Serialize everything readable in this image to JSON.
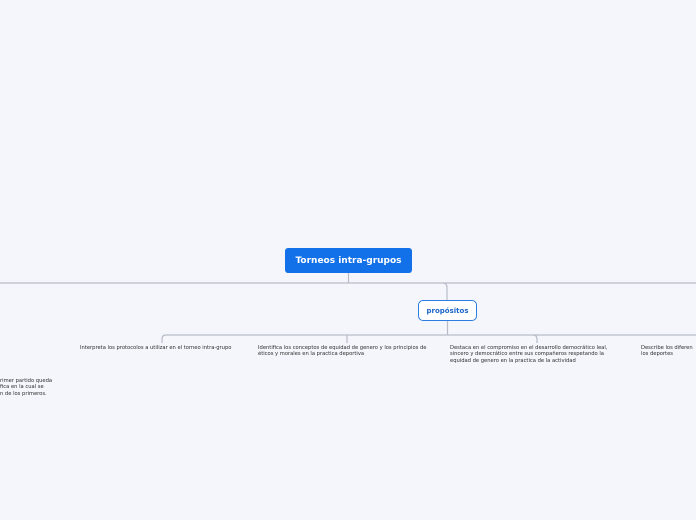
{
  "root": {
    "label": "Torneos intra-grupos"
  },
  "sub": {
    "label": "propósitos"
  },
  "leaves": {
    "item1": "Interpreta los protocolos a utilizar en el torneo intra-grupo",
    "item2": "Identifica los conceptos de equidad de genero y los principios de éticos y morales en la practica deportiva",
    "item3": "Destaca en el compromiso en el desarrollo democrático leal, sincero y democrático entre sus compañeros respetando la equidad de genero en la practica de la actividad",
    "item4_line1": "Describe los diferen",
    "item4_line2": "los deportes",
    "left_line1": "rimer partido queda",
    "left_line2": "fica en la cual se",
    "left_line3": "n de los primeros."
  },
  "colors": {
    "background": "#f4f6fc",
    "root_fill": "#1271e8",
    "sub_border": "#2a7de1",
    "connector": "#b7bcc6"
  }
}
